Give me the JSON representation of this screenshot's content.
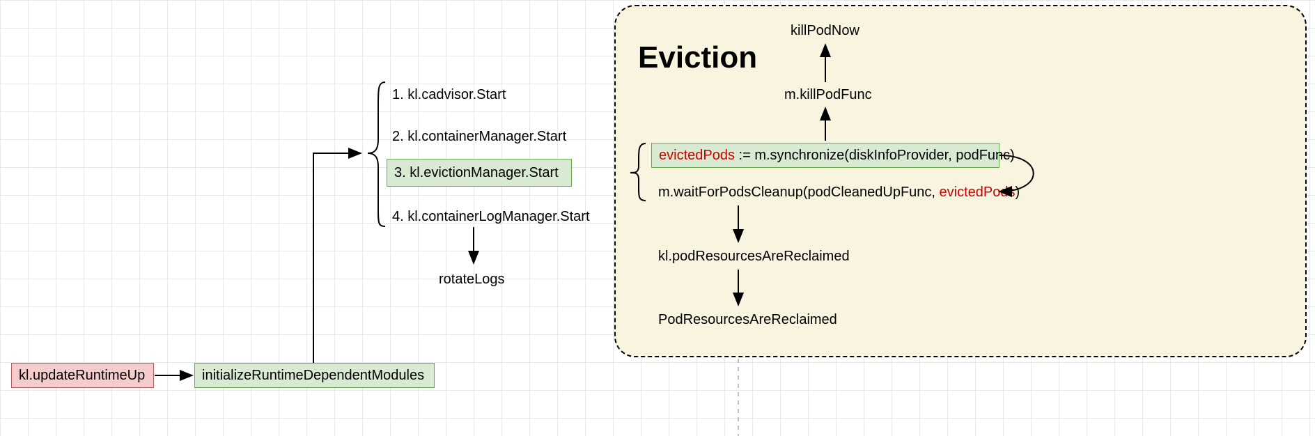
{
  "nodes": {
    "updateRuntimeUp": "kl.updateRuntimeUp",
    "initModules": "initializeRuntimeDependentModules",
    "step1": "1. kl.cadvisor.Start",
    "step2": "2. kl.containerManager.Start",
    "step3": "3. kl.evictionManager.Start",
    "step4": "4. kl.containerLogManager.Start",
    "rotateLogs": "rotateLogs",
    "evictionTitle": "Eviction",
    "killPodNow": "killPodNow",
    "killPodFunc": "m.killPodFunc",
    "synchronizePrefix": "evictedPods",
    "synchronizeRest": " := m.synchronize(diskInfoProvider, podFunc)",
    "waitForCleanupPrefix": "m.waitForPodsCleanup(podCleanedUpFunc, ",
    "waitForCleanupRed": "evictedPods",
    "waitForCleanupSuffix": ")",
    "podResReclaimed1": "kl.podResourcesAreReclaimed",
    "podResReclaimed2": "PodResourcesAreReclaimed"
  }
}
